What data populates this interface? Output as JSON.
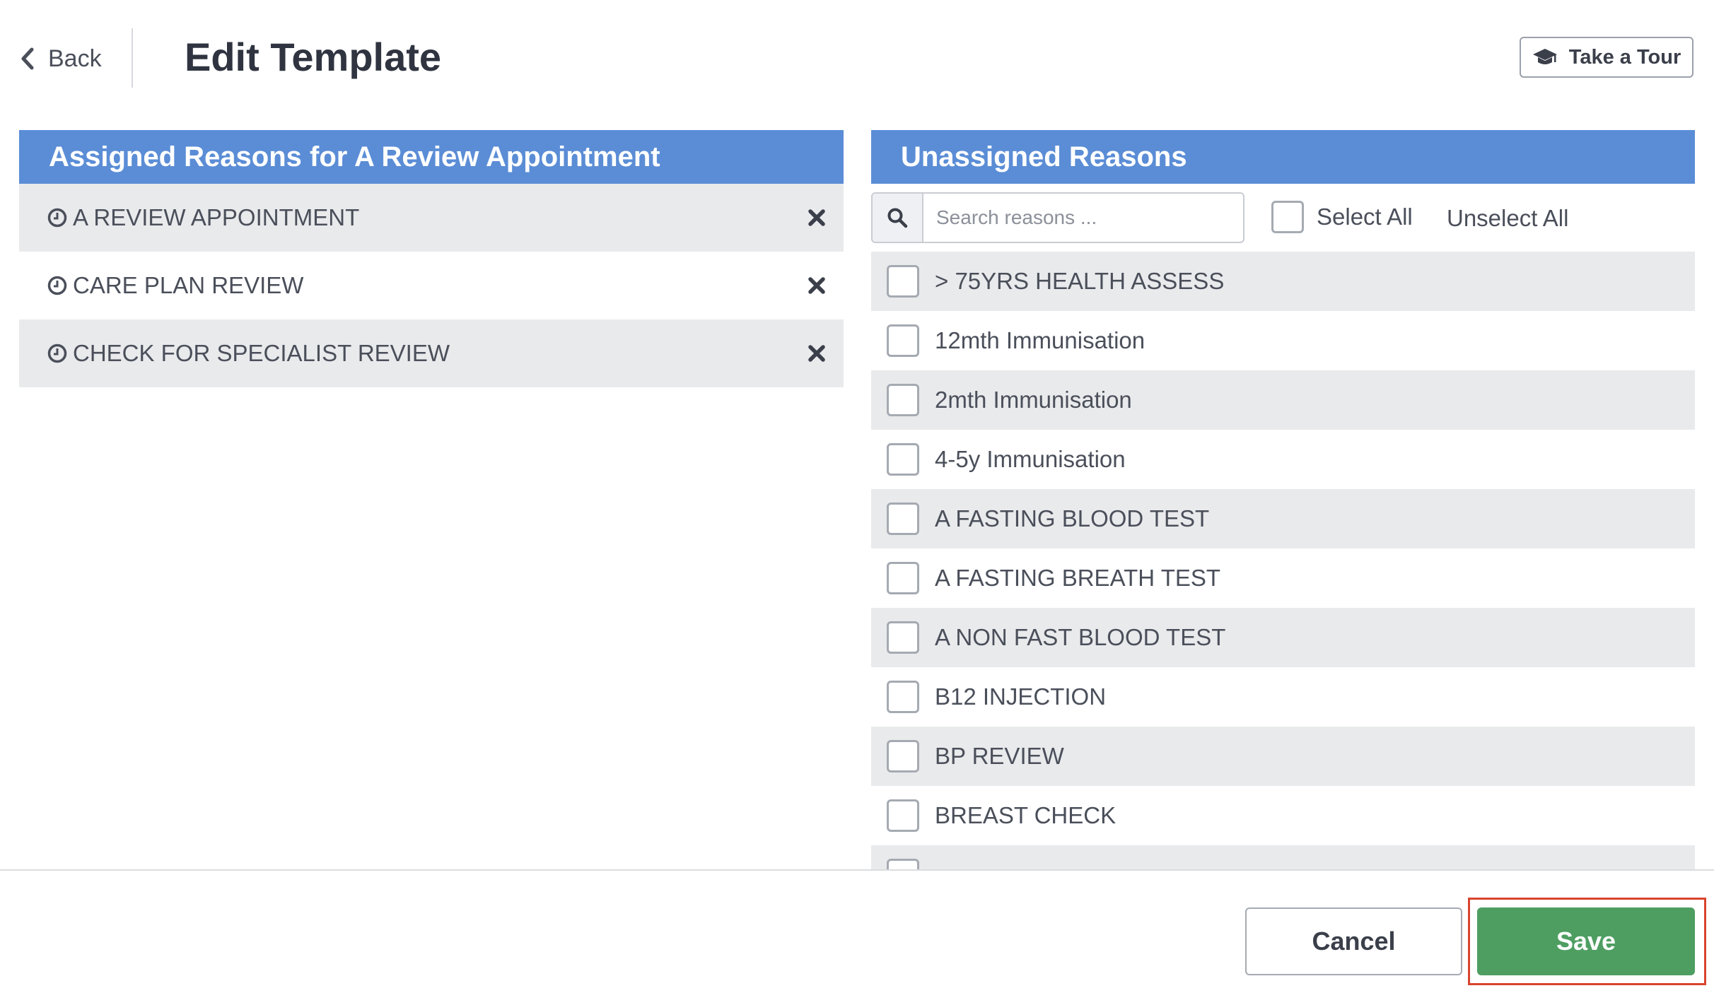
{
  "header": {
    "back_label": "Back",
    "title": "Edit Template",
    "tour_label": "Take a Tour"
  },
  "assigned": {
    "heading": "Assigned Reasons for A Review Appointment",
    "items": [
      {
        "label": "A REVIEW APPOINTMENT"
      },
      {
        "label": "CARE PLAN REVIEW"
      },
      {
        "label": "CHECK FOR SPECIALIST REVIEW"
      }
    ]
  },
  "unassigned": {
    "heading": "Unassigned Reasons",
    "search_placeholder": "Search reasons ...",
    "select_all_label": "Select All",
    "unselect_all_label": "Unselect All",
    "items": [
      {
        "label": "> 75YRS HEALTH ASSESS",
        "checked": false
      },
      {
        "label": "12mth Immunisation",
        "checked": false
      },
      {
        "label": "2mth Immunisation",
        "checked": false
      },
      {
        "label": "4-5y Immunisation",
        "checked": false
      },
      {
        "label": "A FASTING BLOOD TEST",
        "checked": false
      },
      {
        "label": "A FASTING BREATH TEST",
        "checked": false
      },
      {
        "label": "A NON FAST BLOOD TEST",
        "checked": false
      },
      {
        "label": "B12 INJECTION",
        "checked": false
      },
      {
        "label": "BP REVIEW",
        "checked": false
      },
      {
        "label": "BREAST CHECK",
        "checked": false
      }
    ]
  },
  "footer": {
    "cancel_label": "Cancel",
    "save_label": "Save"
  },
  "colors": {
    "panel_header": "#5b8dd6",
    "save_button": "#4e9e62",
    "highlight": "#d9442e",
    "row_alt": "#e9eaec"
  }
}
